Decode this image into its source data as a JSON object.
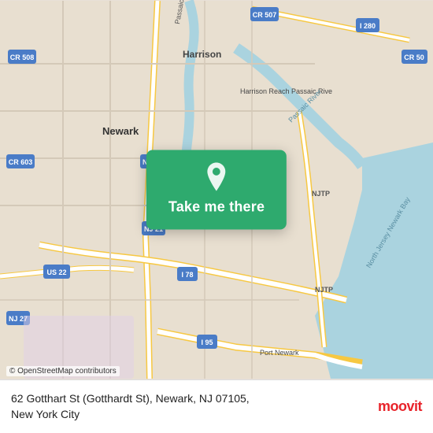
{
  "map": {
    "button_label": "Take me there",
    "osm_attribution": "© OpenStreetMap contributors"
  },
  "info_bar": {
    "address": "62 Gotthart St (Gotthardt St), Newark, NJ 07105,\nNew York City"
  },
  "logo": {
    "text": "moovit"
  }
}
